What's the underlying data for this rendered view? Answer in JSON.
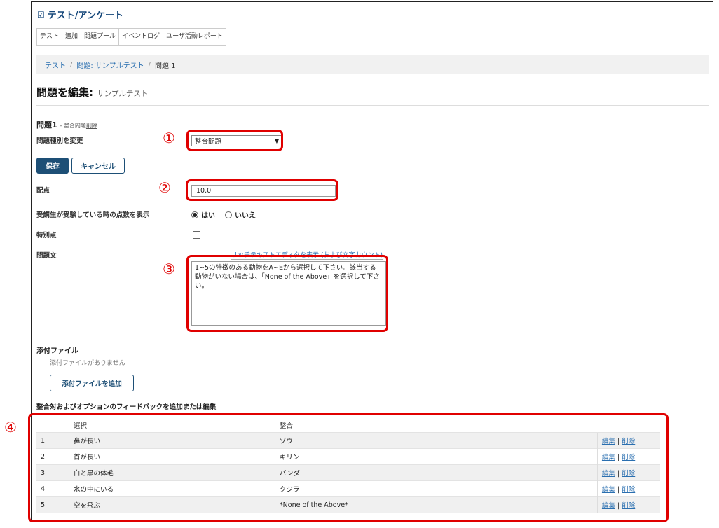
{
  "tool": {
    "title": "テスト/アンケート",
    "icon": "checkbox-icon"
  },
  "tabs": [
    "テスト",
    "追加",
    "問題プール",
    "イベントログ",
    "ユーザ活動レポート"
  ],
  "breadcrumb": {
    "link1": "テスト",
    "link2": "問題: サンプルテスト",
    "current": "問題 1",
    "sep": "/"
  },
  "page_title": {
    "main": "問題を編集:",
    "sub": "サンプルテスト"
  },
  "question": {
    "heading": "問題1",
    "meta": "- 整合問題",
    "delete_link": "削除"
  },
  "form": {
    "type_label": "問題種別を変更",
    "type_value": "整合問題",
    "save": "保存",
    "cancel": "キャンセル",
    "points_label": "配点",
    "points_value": "10.0",
    "show_points_label": "受講生が受験している時の点数を表示",
    "yes": "はい",
    "no": "いいえ",
    "extra_label": "特別点",
    "text_label": "問題文",
    "rich_link": "リッチテキストエディタを表示 (および文字カウント)",
    "question_text": "1~5の特徴のある動物をA~Eから選択して下さい。該当する動物がいない場合は、「None of the Above」を選択して下さい。"
  },
  "attachments": {
    "label": "添付ファイル",
    "none": "添付ファイルがありません",
    "add_button": "添付ファイルを追加"
  },
  "pairs": {
    "label": "整合対およびオプションのフィードバックを追加または編集",
    "headers": [
      "",
      "選択",
      "整合",
      ""
    ],
    "edit": "編集",
    "divider": "|",
    "delete": "削除",
    "rows": [
      {
        "num": "1",
        "choice": "鼻が長い",
        "match": "ゾウ"
      },
      {
        "num": "2",
        "choice": "首が長い",
        "match": "キリン"
      },
      {
        "num": "3",
        "choice": "白と黒の体毛",
        "match": "パンダ"
      },
      {
        "num": "4",
        "choice": "水の中にいる",
        "match": "クジラ"
      },
      {
        "num": "5",
        "choice": "空を飛ぶ",
        "match": "*None of the Above*"
      }
    ]
  },
  "markers": [
    "①",
    "②",
    "③",
    "④"
  ],
  "colors": {
    "accent": "#1d4f76",
    "link": "#2a6fb0",
    "annotation": "#e00000"
  }
}
